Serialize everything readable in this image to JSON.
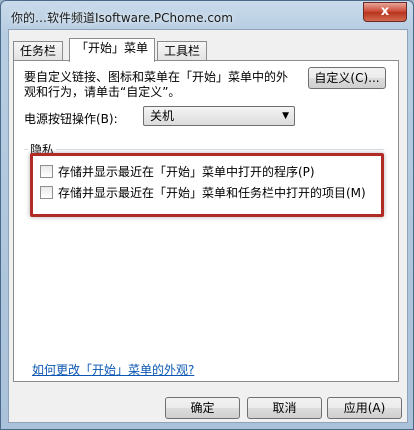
{
  "window": {
    "title": "你的…软件频道Isoftware.PChome.com",
    "close_label": "x"
  },
  "tabs": [
    {
      "label": "任务栏"
    },
    {
      "label": "「开始」菜单"
    },
    {
      "label": "工具栏"
    }
  ],
  "start_menu": {
    "description": "要自定义链接、图标和菜单在「开始」菜单中的外观和行为，请单击“自定义”。",
    "customize_label": "自定义(C)...",
    "power_label": "电源按钮操作(B):",
    "power_value": "关机",
    "privacy": {
      "title": "隐私",
      "items": [
        {
          "label": "存储并显示最近在「开始」菜单中打开的程序(P)",
          "checked": false
        },
        {
          "label": "存储并显示最近在「开始」菜单和任务栏中打开的项目(M)",
          "checked": false
        }
      ]
    },
    "help_link": "如何更改「开始」菜单的外观?"
  },
  "footer": {
    "ok_label": "确定",
    "cancel_label": "取消",
    "apply_label": "应用(A)"
  },
  "colors": {
    "highlight_border": "#b22a24",
    "link": "#0b57b3"
  }
}
